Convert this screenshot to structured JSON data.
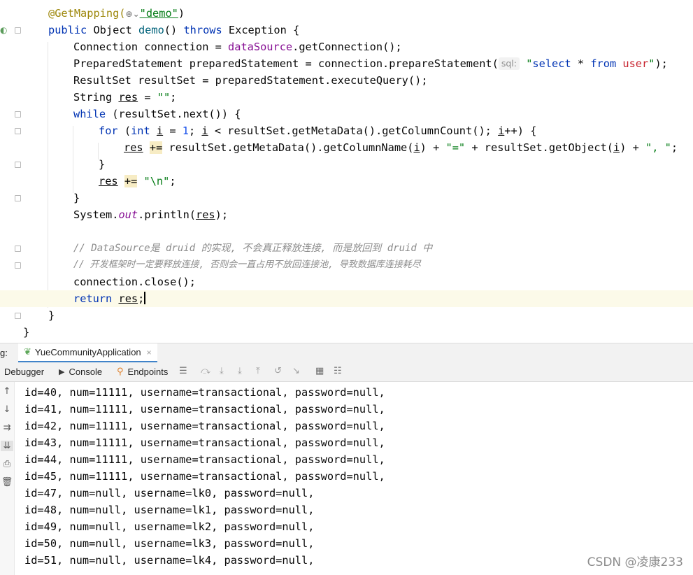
{
  "editor": {
    "annotation": "@GetMapping(",
    "mapping_value": "\"demo\"",
    "mapping_close": ")",
    "method_sig": {
      "kw_public": "public",
      "type": " Object ",
      "name": "demo",
      "params": "() ",
      "kw_throws": "throws",
      "rest": " Exception {"
    },
    "l3": {
      "a": "Connection connection = ",
      "field": "dataSource",
      "b": ".getConnection();"
    },
    "l4": {
      "a": "PreparedStatement preparedStatement = connection.prepareStatement(",
      "hint": "sql:",
      "q1": "\"",
      "s1": "select",
      "s2": " * ",
      "s3": "from",
      "s4": " ",
      "s5": "user",
      "q2": "\"",
      "b": ");"
    },
    "l5": {
      "a": "ResultSet resultSet = preparedStatement.executeQuery();"
    },
    "l6": {
      "a": "String ",
      "var": "res",
      "b": " = ",
      "str": "\"\"",
      "c": ";"
    },
    "l7": {
      "kw": "while",
      "b": " (resultSet.next()) {"
    },
    "l8": {
      "kw": "for",
      "b": " (",
      "kw2": "int",
      "c": " ",
      "v1": "i",
      "d": " = ",
      "n1": "1",
      "e": "; ",
      "v2": "i",
      "f": " < resultSet.getMetaData().getColumnCount(); ",
      "v3": "i",
      "g": "++) {"
    },
    "l9": {
      "v": "res",
      "sp": " ",
      "op": "+=",
      "a": " resultSet.getMetaData().getColumnName(",
      "v1": "i",
      "b": ") + ",
      "s1": "\"=\"",
      "c": " + resultSet.getObject(",
      "v2": "i",
      "d": ") + ",
      "s2": "\", \"",
      "e": ";"
    },
    "l10": {
      "a": "}"
    },
    "l11": {
      "v": "res",
      "sp": " ",
      "op": "+=",
      "a": " ",
      "s": "\"\\n\"",
      "b": ";"
    },
    "l12": {
      "a": "}"
    },
    "l13": {
      "a": "System.",
      "st": "out",
      "b": ".println(",
      "v": "res",
      "c": ");"
    },
    "l15": {
      "cmt": "// DataSource是 druid 的实现, 不会真正释放连接, 而是放回到 druid 中"
    },
    "l16": {
      "cmt": "// 开发框架时一定要释放连接, 否则会一直占用不放回连接池, 导致数据库连接耗尽"
    },
    "l17": {
      "a": "connection.close();"
    },
    "l18": {
      "kw": "return",
      "a": " ",
      "v": "res",
      "b": ";"
    },
    "l19": {
      "a": "}"
    },
    "l20": {
      "a": "}"
    }
  },
  "run_bar": {
    "label": "g:",
    "tab_title": "YueCommunityApplication",
    "close_symbol": "×"
  },
  "toolbar": {
    "debugger_label": "Debugger",
    "console_label": "Console",
    "endpoints_label": "Endpoints"
  },
  "console": {
    "lines": [
      "id=40, num=11111, username=transactional, password=null,",
      "id=41, num=11111, username=transactional, password=null,",
      "id=42, num=11111, username=transactional, password=null,",
      "id=43, num=11111, username=transactional, password=null,",
      "id=44, num=11111, username=transactional, password=null,",
      "id=45, num=11111, username=transactional, password=null,",
      "id=47, num=null, username=lk0, password=null,",
      "id=48, num=null, username=lk1, password=null,",
      "id=49, num=null, username=lk2, password=null,",
      "id=50, num=null, username=lk3, password=null,",
      "id=51, num=null, username=lk4, password=null,"
    ]
  },
  "watermark": "CSDN @凌康233",
  "icons": {
    "web": "globe-icon",
    "run_app": "spring-leaf-icon",
    "console": "console-icon",
    "endpoints": "endpoints-icon"
  },
  "colors": {
    "keyword": "#0033b3",
    "string": "#067d17",
    "annotation": "#9e880d",
    "field": "#871094",
    "comment": "#8c8c8c",
    "current_line": "#fcfae9",
    "tab_underline": "#4083c9"
  }
}
